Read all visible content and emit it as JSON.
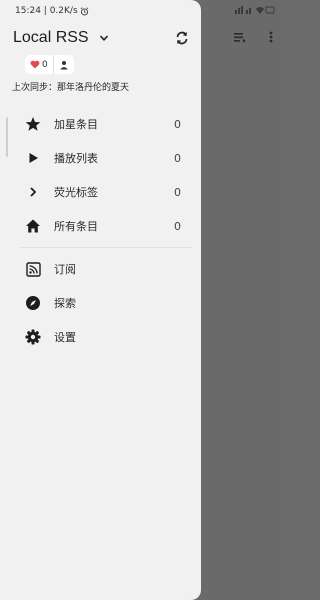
{
  "status": {
    "time_net": "15:24 | 0.2K/s"
  },
  "account": {
    "name": "Local RSS"
  },
  "badges": {
    "hearts": "0"
  },
  "sync": {
    "last_sync": "上次同步：那年洛丹伦的夏天"
  },
  "filters": [
    {
      "icon": "star-icon",
      "label": "加星条目",
      "count": "0"
    },
    {
      "icon": "play-icon",
      "label": "播放列表",
      "count": "0"
    },
    {
      "icon": "chevron-right-icon",
      "label": "荧光标签",
      "count": "0"
    },
    {
      "icon": "home-icon",
      "label": "所有条目",
      "count": "0"
    }
  ],
  "actions": [
    {
      "icon": "rss-feed-icon",
      "label": "订阅"
    },
    {
      "icon": "compass-icon",
      "label": "探索"
    },
    {
      "icon": "gear-icon",
      "label": "设置"
    }
  ],
  "colors": {
    "drawer_bg": "#f1f1f1",
    "scrim": "#6a6a6a",
    "heart": "#e0475a"
  }
}
